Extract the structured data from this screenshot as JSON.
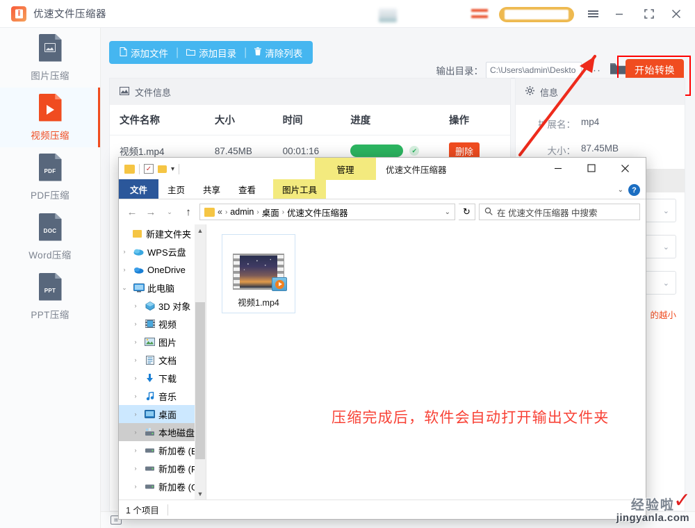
{
  "app": {
    "title": "优速文件压缩器",
    "logo_icon": "compressor-app-icon",
    "titlebar": {
      "menu_icon": "hamburger-menu-icon",
      "minimize_icon": "minimize-icon",
      "maximize_icon": "maximize-icon",
      "close_icon": "close-icon"
    }
  },
  "sidebar": {
    "items": [
      {
        "label": "图片压缩",
        "icon": "image-compress-icon",
        "active": false
      },
      {
        "label": "视频压缩",
        "icon": "video-compress-icon",
        "active": true
      },
      {
        "label": "PDF压缩",
        "icon": "pdf-compress-icon",
        "tag": "PDF",
        "active": false
      },
      {
        "label": "Word压缩",
        "icon": "word-compress-icon",
        "tag": "DOC",
        "active": false
      },
      {
        "label": "PPT压缩",
        "icon": "ppt-compress-icon",
        "tag": "PPT",
        "active": false
      }
    ]
  },
  "toolbar": {
    "add_file": "添加文件",
    "add_folder": "添加目录",
    "clear_list": "清除列表",
    "add_file_icon": "file-icon",
    "add_folder_icon": "folder-icon",
    "clear_list_icon": "trash-icon",
    "output_label": "输出目录：",
    "output_path": "C:\\Users\\admin\\Deskto",
    "browse_dots": "···",
    "folder_icon": "open-folder-icon",
    "start_button": "开始转换",
    "highlight_color": "#ff0000",
    "accent_color": "#f04c20"
  },
  "file_panel": {
    "header": "文件信息",
    "header_icon": "image-info-icon",
    "columns": [
      "文件名称",
      "大小",
      "时间",
      "进度",
      "操作"
    ],
    "rows": [
      {
        "name": "视频1.mp4",
        "size": "87.45MB",
        "time": "00:01:16",
        "progress": 100,
        "status_icon": "check-circle-icon",
        "action": "删除"
      }
    ]
  },
  "info_panel": {
    "header": "信息",
    "header_icon": "gear-icon",
    "fields": [
      {
        "key": "扩展名：",
        "value": "mp4"
      },
      {
        "key": "大小：",
        "value": "87.45MB"
      }
    ],
    "selects": [
      "",
      "",
      ""
    ],
    "chevron_icon": "chevron-down-icon",
    "hint": "的越小"
  },
  "status_bar": {
    "icon": "list-view-icon",
    "text": ""
  },
  "annotations": {
    "arrow": "red-arrow-to-start-button",
    "overlay_note": "压缩完成后，软件会自动打开输出文件夹",
    "note_color": "#f84236"
  },
  "explorer": {
    "window_title": "优速文件压缩器",
    "quick_access": {
      "folder_icon": "folder-icon",
      "properties_icon": "properties-icon",
      "new_folder_icon": "new-folder-icon",
      "dropdown_icon": "chevron-down-icon"
    },
    "contextual_tab": "管理",
    "window_buttons": {
      "minimize": "minimize-icon",
      "maximize": "maximize-icon",
      "close": "close-icon"
    },
    "tabs": [
      {
        "label": "文件",
        "type": "file"
      },
      {
        "label": "主页",
        "type": "normal"
      },
      {
        "label": "共享",
        "type": "normal"
      },
      {
        "label": "查看",
        "type": "normal"
      },
      {
        "label": "图片工具",
        "type": "contextual"
      }
    ],
    "ribbon_collapse_icon": "chevron-down-icon",
    "help_icon": "help-icon",
    "nav": {
      "back_icon": "arrow-left-icon",
      "forward_icon": "arrow-right-icon",
      "history_icon": "chevron-down-icon",
      "up_icon": "arrow-up-icon",
      "refresh_icon": "refresh-icon",
      "path_icon": "folder-icon",
      "path_prefix": "«",
      "breadcrumbs": [
        "admin",
        "桌面",
        "优速文件压缩器"
      ],
      "path_dropdown_icon": "chevron-down-icon"
    },
    "search": {
      "icon": "search-icon",
      "placeholder": "在 优速文件压缩器 中搜索"
    },
    "tree": [
      {
        "label": "新建文件夹",
        "icon": "folder-icon",
        "indent": 1,
        "twisty": "",
        "state": "none"
      },
      {
        "label": "WPS云盘",
        "icon": "wps-cloud-icon",
        "indent": 0,
        "twisty": "›",
        "state": "none"
      },
      {
        "label": "OneDrive",
        "icon": "onedrive-icon",
        "indent": 0,
        "twisty": "›",
        "state": "none"
      },
      {
        "label": "此电脑",
        "icon": "this-pc-icon",
        "indent": 0,
        "twisty": "⌄",
        "state": "none"
      },
      {
        "label": "3D 对象",
        "icon": "3d-objects-icon",
        "indent": 1,
        "twisty": "›",
        "state": "none"
      },
      {
        "label": "视频",
        "icon": "videos-icon",
        "indent": 1,
        "twisty": "›",
        "state": "none"
      },
      {
        "label": "图片",
        "icon": "pictures-icon",
        "indent": 1,
        "twisty": "›",
        "state": "none"
      },
      {
        "label": "文档",
        "icon": "documents-icon",
        "indent": 1,
        "twisty": "›",
        "state": "none"
      },
      {
        "label": "下载",
        "icon": "downloads-icon",
        "indent": 1,
        "twisty": "›",
        "state": "none"
      },
      {
        "label": "音乐",
        "icon": "music-icon",
        "indent": 1,
        "twisty": "›",
        "state": "none"
      },
      {
        "label": "桌面",
        "icon": "desktop-icon",
        "indent": 1,
        "twisty": "›",
        "state": "selected"
      },
      {
        "label": "本地磁盘 (C",
        "icon": "local-disk-icon",
        "indent": 1,
        "twisty": "›",
        "state": "active"
      },
      {
        "label": "新加卷 (E:)",
        "icon": "drive-icon",
        "indent": 1,
        "twisty": "›",
        "state": "none"
      },
      {
        "label": "新加卷 (F:)",
        "icon": "drive-icon",
        "indent": 1,
        "twisty": "›",
        "state": "none"
      },
      {
        "label": "新加卷 (G:)",
        "icon": "drive-icon",
        "indent": 1,
        "twisty": "›",
        "state": "none"
      }
    ],
    "scrollbar": {
      "up_icon": "scroll-up-icon",
      "down_icon": "scroll-down-icon"
    },
    "files": [
      {
        "name": "视频1.mp4",
        "icon": "video-thumbnail",
        "overlay_icon": "media-player-badge",
        "selected": true
      }
    ],
    "status": "1 个项目"
  },
  "watermark": {
    "line1": "经验啦",
    "line2": "jingyanla.com",
    "check_icon": "check-mark-icon"
  }
}
